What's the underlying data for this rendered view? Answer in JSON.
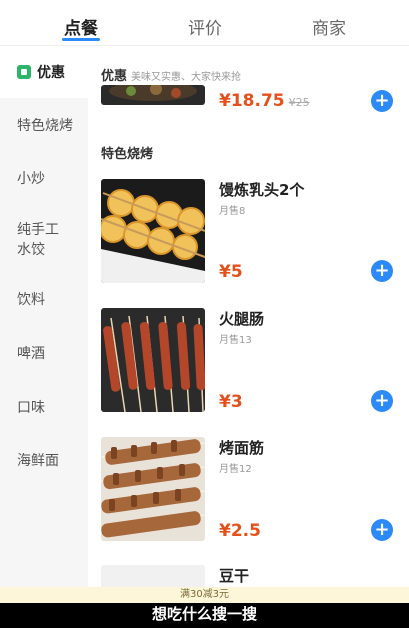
{
  "tabs": [
    {
      "label": "点餐",
      "active": true
    },
    {
      "label": "评价",
      "active": false
    },
    {
      "label": "商家",
      "active": false
    }
  ],
  "sidebar": {
    "items": [
      {
        "label": "优惠",
        "active": true
      },
      {
        "label": "特色烧烤"
      },
      {
        "label": "小炒"
      },
      {
        "label": "纯手工\n水饺"
      },
      {
        "label": "饮料"
      },
      {
        "label": "啤酒"
      },
      {
        "label": "口味"
      },
      {
        "label": "海鲜面"
      }
    ]
  },
  "sections": {
    "promo": {
      "title": "优惠",
      "subtitle": "美味又实惠、大家快来抢"
    },
    "bbq": {
      "title": "特色烧烤"
    }
  },
  "items": [
    {
      "name": "",
      "sold": "",
      "price": "¥18.75",
      "old_price": "¥25"
    },
    {
      "name": "馒炼乳头2个",
      "sold": "月售8",
      "price": "¥5",
      "old_price": ""
    },
    {
      "name": "火腿肠",
      "sold": "月售13",
      "price": "¥3",
      "old_price": ""
    },
    {
      "name": "烤面筋",
      "sold": "月售12",
      "price": "¥2.5",
      "old_price": ""
    },
    {
      "name": "豆干",
      "sold": "",
      "price": "",
      "old_price": ""
    }
  ],
  "add_button_glyph": "+",
  "promo_bar": {
    "text": "满30减3元"
  },
  "caption": {
    "text": "想吃什么搜一搜"
  },
  "colors": {
    "accent": "#2b8af7",
    "price": "#e5501a",
    "promo_green": "#2db36a"
  }
}
